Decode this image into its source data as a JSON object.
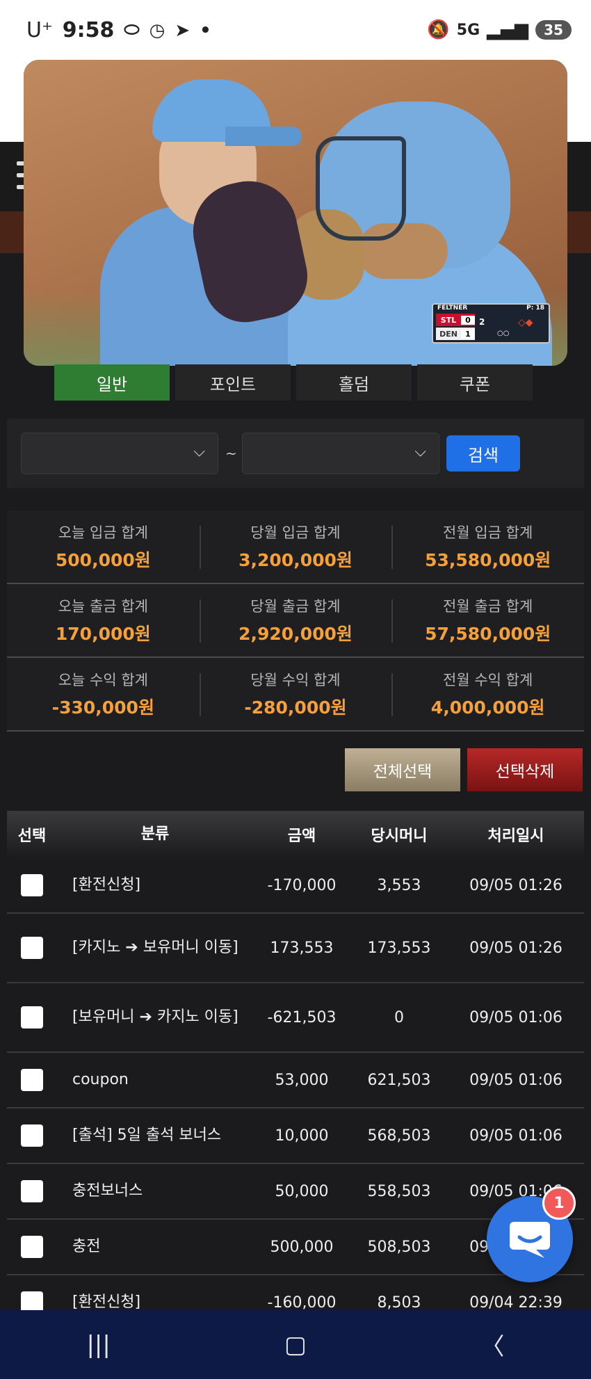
{
  "status_bar": {
    "carrier": "U⁺",
    "time": "9:58",
    "network": "5G",
    "battery": "35"
  },
  "pip": {
    "scorebug": {
      "pitcher": "FELTNER",
      "pitch_count": "P: 18",
      "team_top": "STL",
      "score_top": "0",
      "team_bottom": "DEN",
      "score_bottom": "1",
      "inning": "2",
      "outs": "○○"
    }
  },
  "tabs": [
    {
      "label": "일반",
      "active": true
    },
    {
      "label": "포인트",
      "active": false
    },
    {
      "label": "홀덤",
      "active": false
    },
    {
      "label": "쿠폰",
      "active": false
    }
  ],
  "filter": {
    "start_value": "",
    "end_value": "",
    "separator": "~",
    "search_label": "검색"
  },
  "summary": {
    "rows": [
      [
        {
          "label": "오늘 입금 합계",
          "value": "500,000원"
        },
        {
          "label": "당월 입금 합계",
          "value": "3,200,000원"
        },
        {
          "label": "전월 입금 합계",
          "value": "53,580,000원"
        }
      ],
      [
        {
          "label": "오늘 출금 합계",
          "value": "170,000원"
        },
        {
          "label": "당월 출금 합계",
          "value": "2,920,000원"
        },
        {
          "label": "전월 출금 합계",
          "value": "57,580,000원"
        }
      ],
      [
        {
          "label": "오늘 수익 합계",
          "value": "-330,000원"
        },
        {
          "label": "당월 수익 합계",
          "value": "-280,000원"
        },
        {
          "label": "전월 수익 합계",
          "value": "4,000,000원"
        }
      ]
    ]
  },
  "actions": {
    "select_all": "전체선택",
    "delete_selected": "선택삭제"
  },
  "table": {
    "headers": [
      "선택",
      "분류",
      "금액",
      "당시머니",
      "처리일시"
    ],
    "rows": [
      {
        "category": "[환전신청]",
        "amount": "-170,000",
        "balance": "3,553",
        "time": "09/05 01:26"
      },
      {
        "category": "[카지노 ➔ 보유머니 이동]",
        "amount": "173,553",
        "balance": "173,553",
        "time": "09/05 01:26"
      },
      {
        "category": "[보유머니 ➔ 카지노 이동]",
        "amount": "-621,503",
        "balance": "0",
        "time": "09/05 01:06"
      },
      {
        "category": "coupon",
        "amount": "53,000",
        "balance": "621,503",
        "time": "09/05 01:06"
      },
      {
        "category": "[출석] 5일 출석 보너스",
        "amount": "10,000",
        "balance": "568,503",
        "time": "09/05 01:06"
      },
      {
        "category": "충전보너스",
        "amount": "50,000",
        "balance": "558,503",
        "time": "09/05 01:06"
      },
      {
        "category": "충전",
        "amount": "500,000",
        "balance": "508,503",
        "time": "09/05 01:06"
      },
      {
        "category": "[환전신청]",
        "amount": "-160,000",
        "balance": "8,503",
        "time": "09/04 22:39"
      }
    ]
  },
  "chat": {
    "badge_count": "1"
  }
}
